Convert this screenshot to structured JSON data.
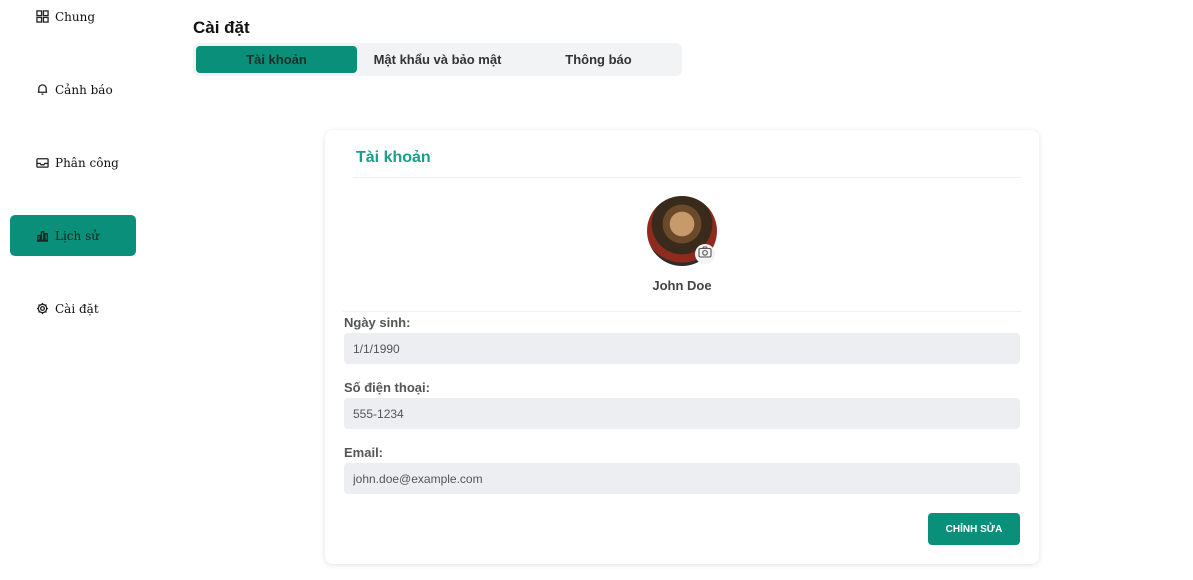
{
  "sidebar": {
    "items": [
      {
        "label": "Chung",
        "icon": "grid-icon"
      },
      {
        "label": "Cảnh báo",
        "icon": "bell-icon"
      },
      {
        "label": "Phân công",
        "icon": "inbox-icon"
      },
      {
        "label": "Lịch sử",
        "icon": "bar-chart-icon",
        "active": true
      },
      {
        "label": "Cài đặt",
        "icon": "gear-icon"
      }
    ]
  },
  "page": {
    "title": "Cài đặt"
  },
  "tabs": [
    {
      "label": "Tài khoản",
      "active": true
    },
    {
      "label": "Mật khẩu và bảo mật"
    },
    {
      "label": "Thông báo"
    }
  ],
  "account": {
    "title": "Tài khoản",
    "user_name": "John Doe",
    "fields": {
      "birthday": {
        "label": "Ngày sinh:",
        "value": "1/1/1990"
      },
      "phone": {
        "label": "Số điện thoại:",
        "value": "555-1234"
      },
      "email": {
        "label": "Email:",
        "value": "john.doe@example.com"
      }
    },
    "edit_label": "CHỈNH SỬA"
  },
  "colors": {
    "accent": "#0a8f7a",
    "title": "#16a08a"
  }
}
